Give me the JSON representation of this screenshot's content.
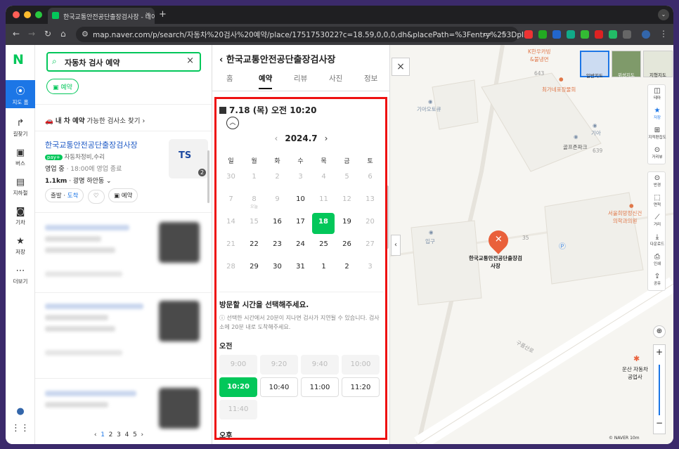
{
  "browser": {
    "tab_title": "한국교통안전공단출장검사장 - 네이",
    "url": "map.naver.com/p/search/자동차%20검사%20예약/place/1751753022?c=18.59,0,0,0,dh&placePath=%3Fentry%253Dpll",
    "colors": {
      "close": "#ff5f57",
      "minimize": "#febc2e",
      "maximize": "#28c840"
    }
  },
  "rail": {
    "logo": "N",
    "items": [
      {
        "label": "지도 홈",
        "icon": "location-icon"
      },
      {
        "label": "길찾기",
        "icon": "directions-icon"
      },
      {
        "label": "버스",
        "icon": "bus-icon"
      },
      {
        "label": "지하철",
        "icon": "subway-icon"
      },
      {
        "label": "기차",
        "icon": "train-icon"
      },
      {
        "label": "저장",
        "icon": "star-icon"
      },
      {
        "label": "더보기",
        "icon": "more-icon"
      }
    ]
  },
  "list": {
    "search_value": "자동차 검사 예약",
    "chip": "예약",
    "mycar": "내 차 예약",
    "mycar_sub": "가능한 검사소 찾기",
    "result": {
      "name": "한국교통안전공단출장검사장",
      "pay": "pay+",
      "category": "자동차정비,수리",
      "status": "영업 중",
      "hours": "· 18:00에 영업 종료",
      "distance": "1.1km",
      "area": "· 광명 하안동",
      "thumb_logo": "TS",
      "thumb_count": "2",
      "btn_depart": "출발",
      "btn_arrive": "도착",
      "btn_reserve": "예약"
    },
    "pages": [
      "1",
      "2",
      "3",
      "4",
      "5"
    ]
  },
  "detail": {
    "title": "한국교통안전공단출장검사장",
    "tabs": [
      "홈",
      "예약",
      "리뷰",
      "사진",
      "정보"
    ],
    "active_tab": 1,
    "selected_date": "7.18 (목) 오전 10:20",
    "month": "2024.7",
    "weekdays": [
      "일",
      "월",
      "화",
      "수",
      "목",
      "금",
      "토"
    ],
    "weeks": [
      [
        {
          "d": "30",
          "s": "dis"
        },
        {
          "d": "1",
          "s": "dis"
        },
        {
          "d": "2",
          "s": "dis"
        },
        {
          "d": "3",
          "s": "dis"
        },
        {
          "d": "4",
          "s": "dis"
        },
        {
          "d": "5",
          "s": "dis"
        },
        {
          "d": "6",
          "s": "dis"
        }
      ],
      [
        {
          "d": "7",
          "s": "dis"
        },
        {
          "d": "8",
          "s": "dis",
          "h": "오늘"
        },
        {
          "d": "9",
          "s": "dis"
        },
        {
          "d": "10",
          "s": ""
        },
        {
          "d": "11",
          "s": "dis"
        },
        {
          "d": "12",
          "s": "dis"
        },
        {
          "d": "13",
          "s": "dis"
        }
      ],
      [
        {
          "d": "14",
          "s": "dis"
        },
        {
          "d": "15",
          "s": "dis"
        },
        {
          "d": "16",
          "s": ""
        },
        {
          "d": "17",
          "s": ""
        },
        {
          "d": "18",
          "s": "sel"
        },
        {
          "d": "19",
          "s": ""
        },
        {
          "d": "20",
          "s": "dis"
        }
      ],
      [
        {
          "d": "21",
          "s": "dis"
        },
        {
          "d": "22",
          "s": ""
        },
        {
          "d": "23",
          "s": ""
        },
        {
          "d": "24",
          "s": ""
        },
        {
          "d": "25",
          "s": ""
        },
        {
          "d": "26",
          "s": ""
        },
        {
          "d": "27",
          "s": "dis"
        }
      ],
      [
        {
          "d": "28",
          "s": "dis"
        },
        {
          "d": "29",
          "s": ""
        },
        {
          "d": "30",
          "s": ""
        },
        {
          "d": "31",
          "s": ""
        },
        {
          "d": "1",
          "s": ""
        },
        {
          "d": "2",
          "s": ""
        },
        {
          "d": "3",
          "s": "dis"
        }
      ]
    ],
    "visit_title": "방문할 시간을 선택해주세요.",
    "note": "선택한 시간에서 20분이 지나면 검사가 지연될 수 있습니다. 검사소에 20분 내로 도착해주세요.",
    "am_label": "오전",
    "pm_label": "오후",
    "am_slots": [
      {
        "t": "9:00",
        "s": "dis"
      },
      {
        "t": "9:20",
        "s": "dis"
      },
      {
        "t": "9:40",
        "s": "dis"
      },
      {
        "t": "10:00",
        "s": "dis"
      },
      {
        "t": "10:20",
        "s": "on"
      },
      {
        "t": "10:40",
        "s": "en"
      },
      {
        "t": "11:00",
        "s": "en"
      },
      {
        "t": "11:20",
        "s": "en"
      },
      {
        "t": "11:40",
        "s": "dis"
      }
    ]
  },
  "map": {
    "labels": [
      {
        "t": "K한우카빙\n&불냉면",
        "c": "#e0784a"
      },
      {
        "t": "643",
        "c": "#999"
      },
      {
        "t": "최가네포장물회",
        "c": "#e0784a"
      },
      {
        "t": "기아오토큐",
        "c": "#7b8fa8"
      },
      {
        "t": "기아",
        "c": "#7b8fa8"
      },
      {
        "t": "골프존파크",
        "c": "#555"
      },
      {
        "t": "639",
        "c": "#999"
      },
      {
        "t": "서울희망정신건\n의학과의원",
        "c": "#e0784a"
      },
      {
        "t": "입구",
        "c": "#7b8fa8"
      },
      {
        "t": "35",
        "c": "#999"
      },
      {
        "t": "한국교통안전공단출장검\n사장",
        "c": "#222"
      },
      {
        "t": "구름산로",
        "c": "#999"
      },
      {
        "t": "운산 자동차\n공업사",
        "c": "#222"
      }
    ],
    "map_types": [
      "일반지도",
      "위성지도",
      "지형지도"
    ],
    "tools": [
      "테마",
      "저장",
      "지적편집도",
      "거리뷰",
      "반경",
      "면적",
      "거리",
      "다운로드",
      "인쇄",
      "공유"
    ],
    "scale": "© NAVER   10m"
  }
}
